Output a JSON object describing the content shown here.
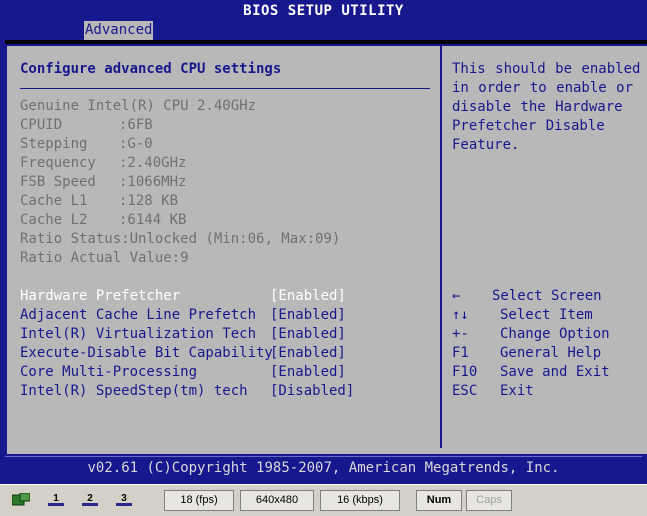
{
  "title": "BIOS SETUP UTILITY",
  "tabs": [
    {
      "label": "Advanced",
      "active": true
    }
  ],
  "main": {
    "heading": "Configure advanced CPU settings",
    "info": [
      {
        "label": "Genuine Intel(R) CPU 2.40GHz",
        "value": ""
      },
      {
        "label": "CPUID",
        "value": ":6FB"
      },
      {
        "label": "Stepping",
        "value": ":G-0"
      },
      {
        "label": "Frequency",
        "value": ":2.40GHz"
      },
      {
        "label": "FSB Speed",
        "value": ":1066MHz"
      },
      {
        "label": "Cache L1",
        "value": ":128 KB"
      },
      {
        "label": "Cache L2",
        "value": ":6144 KB"
      },
      {
        "label": "Ratio Status",
        "value": ":Unlocked (Min:06, Max:09)"
      },
      {
        "label": "Ratio Actual Value",
        "value": ":9"
      }
    ],
    "options": [
      {
        "label": "Hardware Prefetcher",
        "value": "[Enabled]",
        "selected": true
      },
      {
        "label": "Adjacent Cache Line Prefetch",
        "value": "[Enabled]",
        "selected": false
      },
      {
        "label": "Intel(R) Virtualization Tech",
        "value": "[Enabled]",
        "selected": false
      },
      {
        "label": "Execute-Disable Bit Capability",
        "value": "[Enabled]",
        "selected": false
      },
      {
        "label": "Core Multi-Processing",
        "value": "[Enabled]",
        "selected": false
      },
      {
        "label": "Intel(R) SpeedStep(tm) tech",
        "value": "[Disabled]",
        "selected": false
      }
    ]
  },
  "help": {
    "text": "This should be enabled in order to enable or disable the Hardware Prefetcher Disable Feature.",
    "keys": [
      {
        "key": "←",
        "action": "Select Screen"
      },
      {
        "key": "↑↓",
        "action": "Select Item"
      },
      {
        "key": "+-",
        "action": "Change Option"
      },
      {
        "key": "F1",
        "action": "General Help"
      },
      {
        "key": "F10",
        "action": "Save and Exit"
      },
      {
        "key": "ESC",
        "action": "Exit"
      }
    ]
  },
  "footer": {
    "copyright": "v02.61 (C)Copyright 1985-2007, American Megatrends, Inc."
  },
  "statusbar": {
    "buttons": [
      "1",
      "2",
      "3"
    ],
    "fps": "18 (fps)",
    "resolution": "640x480",
    "bandwidth": "16 (kbps)",
    "num": "Num",
    "caps": "Caps"
  },
  "colors": {
    "bios_blue": "#18188e",
    "bios_gray": "#b8b8b8",
    "highlight": "#ffffff",
    "dim_text": "#707070"
  }
}
